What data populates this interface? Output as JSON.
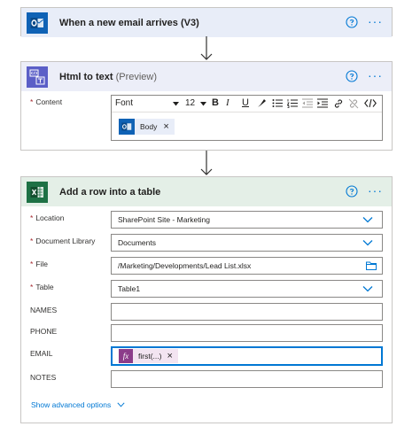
{
  "trigger": {
    "title": "When a new email arrives (V3)",
    "icon": "outlook-icon",
    "more_label": "···"
  },
  "html_to_text": {
    "title": "Html to text",
    "subtitle": "(Preview)",
    "icon": "html-to-text-icon",
    "more_label": "···",
    "content_label": "Content",
    "required_mark": "*",
    "toolbar": {
      "font_label": "Font",
      "size_label": "12",
      "bold_label": "B",
      "italic_label": "I",
      "underline_label": "U"
    },
    "token_label": "Body",
    "token_remove": "×"
  },
  "add_row": {
    "title": "Add a row into a table",
    "icon": "excel-icon",
    "more_label": "···",
    "required_mark": "*",
    "fields": {
      "location": {
        "label": "Location",
        "value": "SharePoint Site - Marketing"
      },
      "document_library": {
        "label": "Document Library",
        "value": "Documents"
      },
      "file": {
        "label": "File",
        "value": "/Marketing/Developments/Lead List.xlsx"
      },
      "table": {
        "label": "Table",
        "value": "Table1"
      },
      "names": {
        "label": "NAMES",
        "value": ""
      },
      "phone": {
        "label": "PHONE",
        "value": ""
      },
      "email": {
        "label": "EMAIL",
        "token_label": "first(...)",
        "token_icon": "fx",
        "token_remove": "×"
      },
      "notes": {
        "label": "NOTES",
        "value": ""
      }
    },
    "advanced_label": "Show advanced options"
  },
  "colors": {
    "trigger_header_bg": "#e8edf8",
    "html_header_bg": "#eceef8",
    "excel_header_bg": "#e4efe7",
    "outlook_blue": "#0f62b5",
    "html_purple": "#5b5fc7",
    "excel_green": "#1e7145",
    "link_blue": "#0078d4",
    "token_pink": "#f3e4f1",
    "token_fx": "#8c3c8a"
  }
}
